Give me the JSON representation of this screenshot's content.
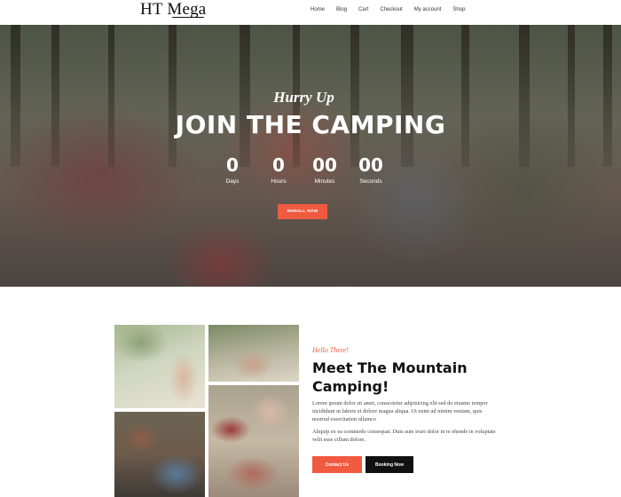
{
  "header": {
    "logo_ht": "HT",
    "logo_mega": "Mega",
    "nav": [
      "Home",
      "Blog",
      "Cart",
      "Checkout",
      "My account",
      "Shop"
    ]
  },
  "hero": {
    "subtitle": "Hurry Up",
    "title": "JOIN THE CAMPING",
    "countdown": [
      {
        "value": "0",
        "label": "Days"
      },
      {
        "value": "0",
        "label": "Hours"
      },
      {
        "value": "00",
        "label": "Minutes"
      },
      {
        "value": "00",
        "label": "Seconds"
      }
    ],
    "enroll_label": "ENROLL NOW"
  },
  "intro": {
    "hello": "Hello There!",
    "title": "Meet The Mountain Camping!",
    "para1": "Lorem ipsum dolor sit amet, consectetur adipisicing elit sed do eiusmo tempor incididunt ut labore et dolore magna aliqua. Ut enim ad minim veniam, quis nostrud exercitation ullamco",
    "para2": "Aliquip ex ea commodo consequat. Duis aute irure dolor in re ehende in voluptate velit esse cillum dolore.",
    "contact_label": "Contact Us",
    "booking_label": "Booking Now"
  },
  "colors": {
    "accent": "#f05a40",
    "dark": "#111111"
  }
}
